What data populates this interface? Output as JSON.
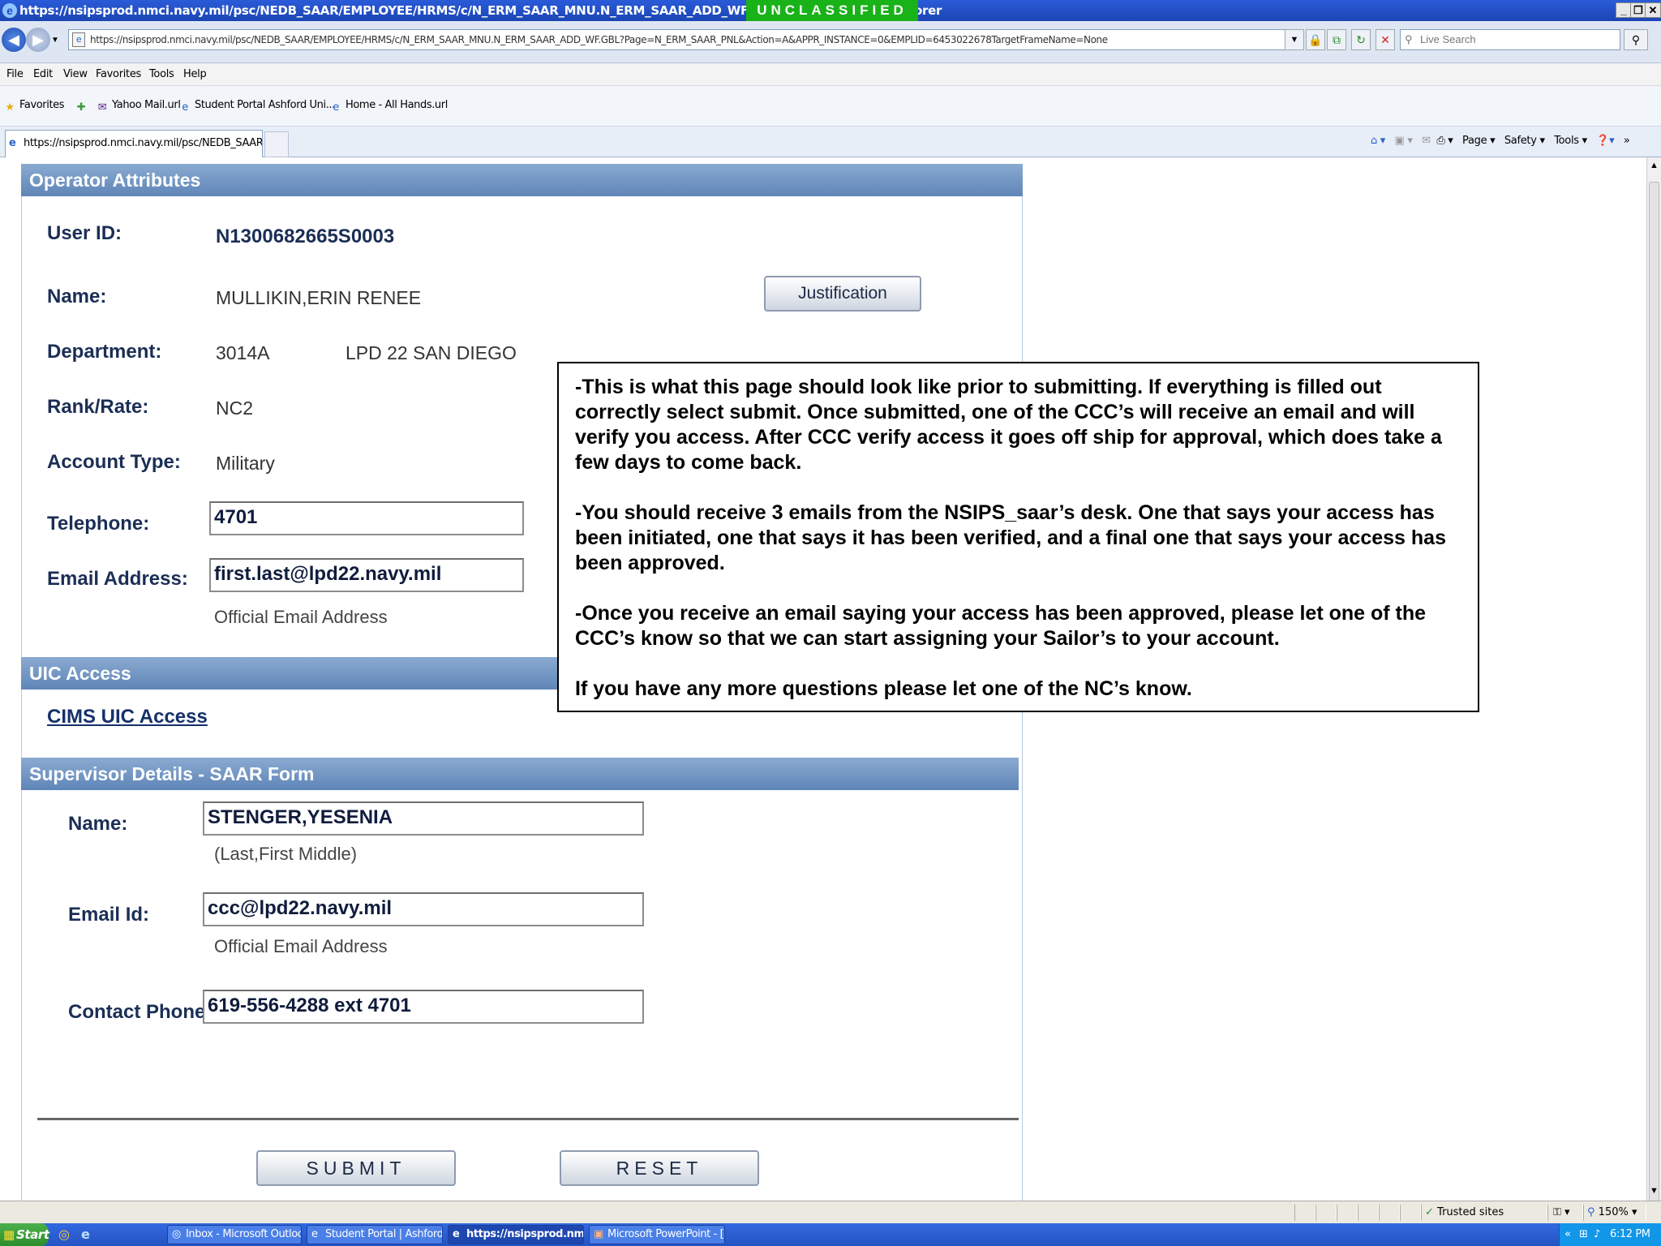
{
  "window": {
    "title": "https://nsipsprod.nmci.navy.mil/psc/NEDB_SAAR/EMPLOYEE/HRMS/c/N_ERM_SAAR_MNU.N_ERM_SAAR_ADD_WF. - Windows Internet Explorer",
    "classification": "UNCLASSIFIED"
  },
  "address_bar": {
    "url": "https://nsipsprod.nmci.navy.mil/psc/NEDB_SAAR/EMPLOYEE/HRMS/c/N_ERM_SAAR_MNU.N_ERM_SAAR_ADD_WF.GBL?Page=N_ERM_SAAR_PNL&Action=A&APPR_INSTANCE=0&EMPLID=6453022678TargetFrameName=None",
    "search_placeholder": "Live Search"
  },
  "menu": [
    "File",
    "Edit",
    "View",
    "Favorites",
    "Tools",
    "Help"
  ],
  "favorites": {
    "label": "Favorites",
    "items": [
      "Yahoo Mail.url",
      "Student Portal  Ashford Uni...",
      "Home - All Hands.url"
    ]
  },
  "tab": {
    "title": "https://nsipsprod.nmci.navy.mil/psc/NEDB_SAAR/EMP..."
  },
  "command_bar": [
    "Page",
    "Safety",
    "Tools"
  ],
  "operator": {
    "header": "Operator Attributes",
    "user_id_label": "User ID:",
    "user_id": "N1300682665S0003",
    "name_label": "Name:",
    "name": "MULLIKIN,ERIN RENEE",
    "justification_button": "Justification",
    "department_label": "Department:",
    "department_code": "3014A",
    "department_name": "LPD 22 SAN DIEGO",
    "rank_label": "Rank/Rate:",
    "rank": "NC2",
    "account_type_label": "Account Type:",
    "account_type": "Military",
    "telephone_label": "Telephone:",
    "telephone": "4701",
    "email_label": "Email Address:",
    "email": "first.last@lpd22.navy.mil",
    "email_hint": "Official Email Address"
  },
  "uic": {
    "header": "UIC Access",
    "link": "CIMS UIC Access"
  },
  "supervisor": {
    "header": "Supervisor Details - SAAR Form",
    "name_label": "Name:",
    "name": "STENGER,YESENIA",
    "name_hint": "(Last,First Middle)",
    "email_label": "Email Id:",
    "email": "ccc@lpd22.navy.mil",
    "email_hint": "Official Email Address",
    "phone_label": "Contact Phone:",
    "phone": "619-556-4288 ext 4701"
  },
  "actions": {
    "submit": "SUBMIT",
    "reset": "RESET"
  },
  "callout": {
    "p1": "-This is what this page should look like prior to submitting. If everything is filled out correctly select submit. Once submitted, one of the CCC’s will receive an email and will verify you access. After CCC verify access it goes off ship for approval, which does take a few days to come back.",
    "p2": "-You should receive 3 emails from the NSIPS_saar’s desk. One that says your access has been initiated, one that says it has been verified, and a final one that says your access has been approved.",
    "p3": "-Once you receive an email saying your access has been approved, please let one of the CCC’s know so that we can start assigning your Sailor’s to your account.",
    "p4": "If you have any more questions please let one of the NC’s know."
  },
  "status_bar": {
    "zone": "Trusted sites",
    "zoom": "150%"
  },
  "taskbar": {
    "start": "Start",
    "tasks": [
      "Inbox - Microsoft Outlook",
      "Student Portal | Ashford ...",
      "https://nsipsprod.nm...",
      "Microsoft PowerPoint - [..."
    ],
    "clock": "6:12 PM"
  }
}
